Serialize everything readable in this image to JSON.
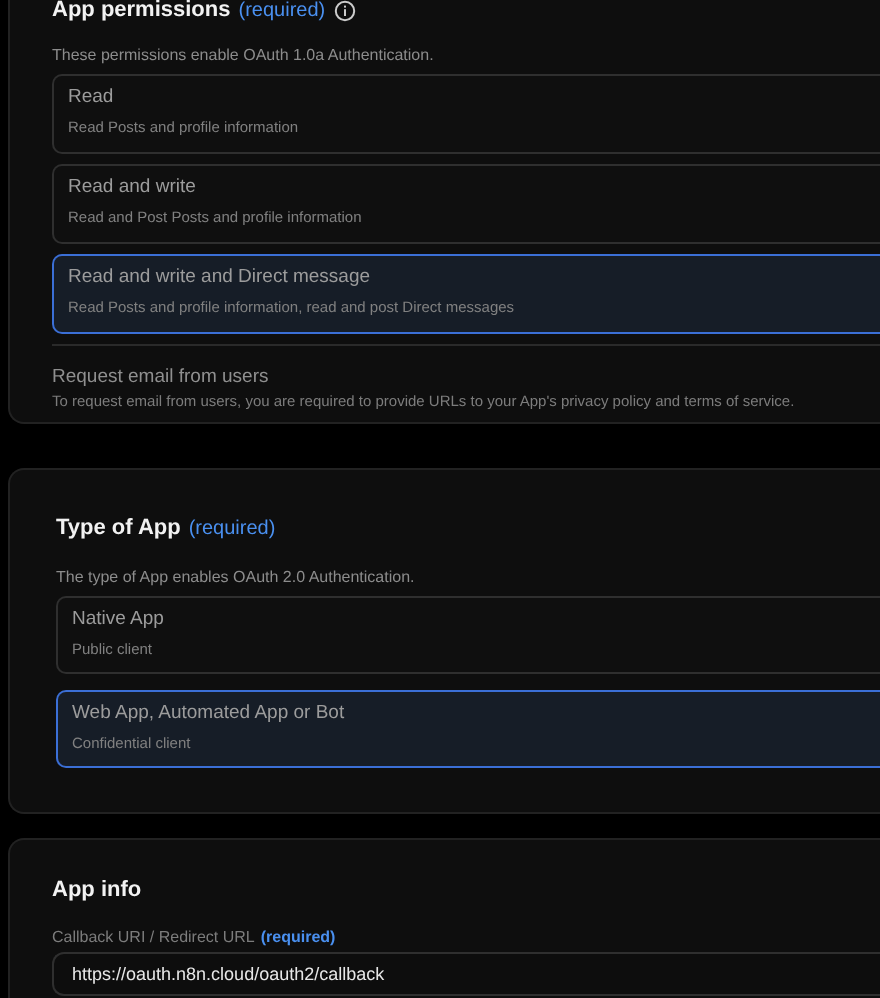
{
  "app_permissions": {
    "title": "App permissions",
    "required": "(required)",
    "description": "These permissions enable OAuth 1.0a Authentication.",
    "options": [
      {
        "title": "Read",
        "subtitle": "Read Posts and profile information",
        "selected": false
      },
      {
        "title": "Read and write",
        "subtitle": "Read and Post Posts and profile information",
        "selected": false
      },
      {
        "title": "Read and write and Direct message",
        "subtitle": "Read Posts and profile information, read and post Direct messages",
        "selected": true
      }
    ],
    "email_request": {
      "title": "Request email from users",
      "description": "To request email from users, you are required to provide URLs to your App's privacy policy and terms of service."
    }
  },
  "type_of_app": {
    "title": "Type of App",
    "required": "(required)",
    "description": "The type of App enables OAuth 2.0 Authentication.",
    "options": [
      {
        "title": "Native App",
        "subtitle": "Public client",
        "selected": false
      },
      {
        "title": "Web App, Automated App or Bot",
        "subtitle": "Confidential client",
        "selected": true
      }
    ]
  },
  "app_info": {
    "title": "App info",
    "callback_label": "Callback URI / Redirect URL",
    "required": "(required)",
    "callback_value": "https://oauth.n8n.cloud/oauth2/callback"
  }
}
